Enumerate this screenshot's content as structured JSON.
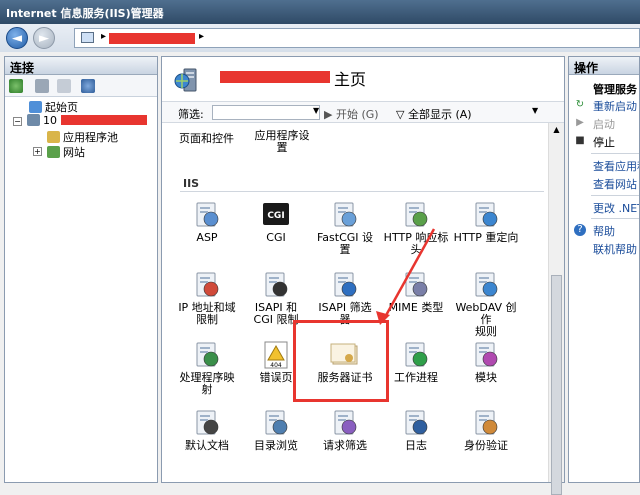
{
  "window": {
    "title": "Internet 信息服务(IIS)管理器"
  },
  "colors": {
    "redact": "#e8352f",
    "highlight": "#e8352f",
    "link": "#1a4c9a"
  },
  "connections": {
    "header": "连接",
    "tree": [
      {
        "label": "起始页",
        "icon": "start-page-icon"
      },
      {
        "label": "10",
        "icon": "server-icon"
      },
      {
        "label": "应用程序池",
        "icon": "app-pool-icon"
      },
      {
        "label": "网站",
        "icon": "sites-icon"
      }
    ]
  },
  "main": {
    "title_suffix": "主页",
    "filter": {
      "label": "筛选:",
      "go": "开始 (G)",
      "show_all": "全部显示 (A)"
    },
    "top_items": [
      "页面和控件",
      "应用程序设\n置"
    ],
    "group": "IIS",
    "features": [
      {
        "label": "ASP",
        "icon": "asp-icon"
      },
      {
        "label": "CGI",
        "icon": "cgi-icon"
      },
      {
        "label": "FastCGI 设\n置",
        "icon": "fastcgi-icon"
      },
      {
        "label": "HTTP 响应标\n头",
        "icon": "http-headers-icon"
      },
      {
        "label": "HTTP 重定向",
        "icon": "http-redirect-icon"
      },
      {
        "label": "IP 地址和域\n限制",
        "icon": "ip-restrict-icon"
      },
      {
        "label": "ISAPI 和\nCGI 限制",
        "icon": "isapi-cgi-icon"
      },
      {
        "label": "ISAPI 筛选\n器",
        "icon": "isapi-filter-icon"
      },
      {
        "label": "MIME 类型",
        "icon": "mime-icon"
      },
      {
        "label": "WebDAV 创作\n规则",
        "icon": "webdav-icon"
      },
      {
        "label": "处理程序映\n射",
        "icon": "handler-icon"
      },
      {
        "label": "错误页",
        "icon": "error-page-icon"
      },
      {
        "label": "服务器证书",
        "icon": "certificate-icon"
      },
      {
        "label": "工作进程",
        "icon": "worker-process-icon"
      },
      {
        "label": "模块",
        "icon": "modules-icon"
      },
      {
        "label": "默认文档",
        "icon": "default-doc-icon"
      },
      {
        "label": "目录浏览",
        "icon": "dir-browse-icon"
      },
      {
        "label": "请求筛选",
        "icon": "request-filter-icon"
      },
      {
        "label": "日志",
        "icon": "logging-icon"
      },
      {
        "label": "身份验证",
        "icon": "auth-icon"
      }
    ]
  },
  "actions": {
    "header": "操作",
    "manage_header": "管理服务",
    "items": [
      "重新启动",
      "启动",
      "停止",
      "查看应用程",
      "查看网站",
      "更改 .NET",
      "帮助",
      "联机帮助"
    ]
  }
}
